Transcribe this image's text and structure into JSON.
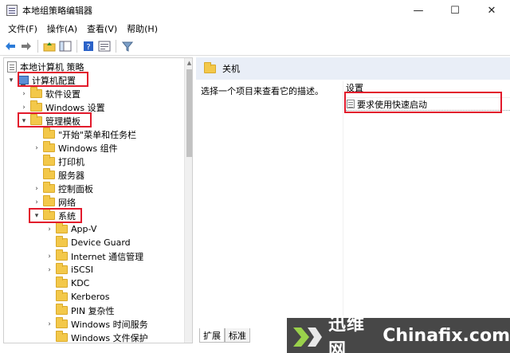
{
  "window": {
    "title": "本地组策略编辑器",
    "minimize": "—",
    "maximize": "☐",
    "close": "✕"
  },
  "menu": [
    "文件(F)",
    "操作(A)",
    "查看(V)",
    "帮助(H)"
  ],
  "toolbar": {
    "icons": [
      "back-icon",
      "forward-icon",
      "up-folder-icon",
      "show-hide-tree-icon",
      "help-icon",
      "properties-icon",
      "filter-icon"
    ]
  },
  "tree": {
    "root": "本地计算机 策略",
    "computer_config": "计算机配置",
    "software_settings": "软件设置",
    "windows_settings": "Windows 设置",
    "admin_templates": "管理模板",
    "start_menu": "\"开始\"菜单和任务栏",
    "windows_components": "Windows 组件",
    "printers": "打印机",
    "servers": "服务器",
    "control_panel": "控制面板",
    "network": "网络",
    "system": "系统",
    "system_children": [
      "App-V",
      "Device Guard",
      "Internet 通信管理",
      "iSCSI",
      "KDC",
      "Kerberos",
      "PIN 复杂性",
      "Windows 时间服务",
      "Windows 文件保护"
    ]
  },
  "right": {
    "header": "关机",
    "description": "选择一个项目来查看它的描述。",
    "column_header": "设置",
    "setting": "要求使用快速启动"
  },
  "tabs": [
    "扩展",
    "标准"
  ],
  "annotations": {
    "color": "#e21a2c"
  },
  "watermark": {
    "left_text": "迅维网",
    "right_text": "Chinafix.com"
  }
}
